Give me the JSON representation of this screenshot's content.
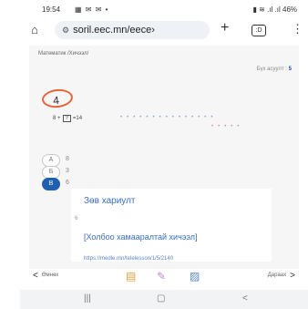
{
  "status_bar": {
    "time": "19:54",
    "icons": "▦ ✉ ✉ •",
    "right": "▮ ≋ .ıl .ıl 46%"
  },
  "browser": {
    "url": "soril.eec.mn/eece›",
    "tabs_count": ":D"
  },
  "page": {
    "breadcrumb": "Математик /Хичээл/",
    "score_label": "Бүх асуулт :",
    "score_value": "5",
    "question_number": "4",
    "equation_left": "8 +",
    "equation_box": "?",
    "equation_right": "=14",
    "options": [
      {
        "letter": "A",
        "value": "8"
      },
      {
        "letter": "Б",
        "value": "3"
      },
      {
        "letter": "В",
        "value": "6"
      }
    ],
    "answer_title": "Зөв хариулт",
    "answer_value": "6",
    "answer_link_text": "[Холбоо хамааралтай хичээл]",
    "answer_url": "https://medle.mn/telelesson/1/5/2140"
  },
  "bottom_nav": {
    "prev_label": "Өмнөх",
    "next_label": "Дараах"
  },
  "colors": {
    "accent": "#1f5fb0",
    "link": "#3a6fc0",
    "circle": "#e8633a"
  }
}
